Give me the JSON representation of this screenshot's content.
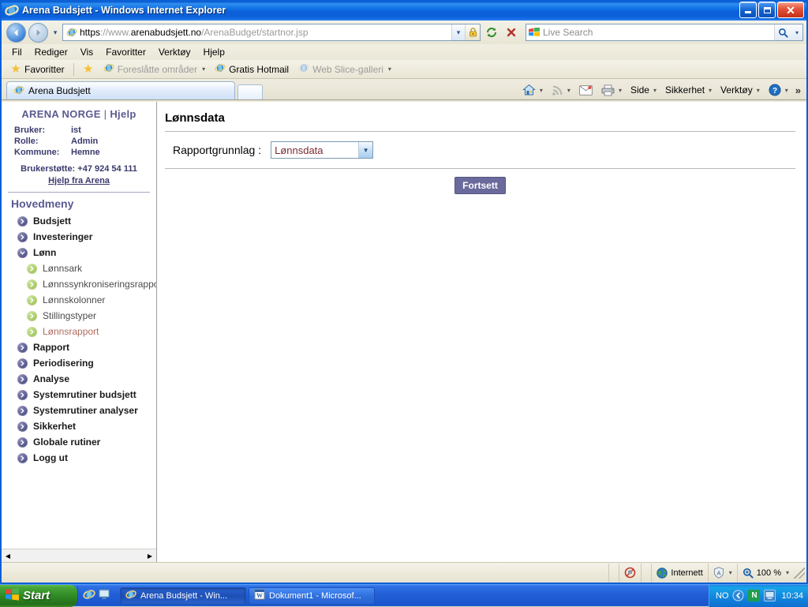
{
  "window": {
    "title": "Arena Budsjett - Windows Internet Explorer",
    "minimize_label": "Minimer",
    "restore_label": "Gjenopprett",
    "close_label": "Lukk"
  },
  "navigation": {
    "back_label": "Tilbake",
    "forward_label": "Fremover",
    "history_label": "Nylige sider",
    "url_scheme": "https",
    "url_sep": "://www.",
    "url_host": "arenabudsjett.no",
    "url_path": "/ArenaBudget/startnor.jsp",
    "url_full": "https://www.arenabudsjett.no/ArenaBudget/startnor.jsp",
    "refresh_label": "Oppdater",
    "stop_label": "Stopp",
    "lock_label": "Sikkerhetsrapport"
  },
  "search": {
    "placeholder": "Live Search",
    "go_label": "Søk",
    "provider_label": "Søkeleverandører"
  },
  "menu": {
    "items": [
      {
        "label": "Fil"
      },
      {
        "label": "Rediger"
      },
      {
        "label": "Vis"
      },
      {
        "label": "Favoritter"
      },
      {
        "label": "Verktøy"
      },
      {
        "label": "Hjelp"
      }
    ]
  },
  "favorites_bar": {
    "favorites_label": "Favoritter",
    "items": [
      {
        "label": "Foreslåtte områder",
        "dim": true,
        "caret": true
      },
      {
        "label": "Gratis Hotmail",
        "dim": false,
        "caret": false
      },
      {
        "label": "Web Slice-galleri",
        "dim": true,
        "caret": true
      }
    ]
  },
  "tabs": {
    "items": [
      {
        "label": "Arena Budsjett"
      }
    ],
    "new_tab_label": "Ny fane"
  },
  "command_bar": {
    "home_label": "Hjem",
    "feeds_label": "Feeds",
    "mail_label": "Les e-post",
    "print_label": "Skriv ut",
    "items": [
      {
        "label": "Side"
      },
      {
        "label": "Sikkerhet"
      },
      {
        "label": "Verktøy"
      }
    ],
    "help_label": "Hjelp",
    "overflow_label": "»"
  },
  "sidebar": {
    "brand": "ARENA NORGE",
    "separator": "|",
    "help_link": "Hjelp",
    "info": [
      {
        "key": "Bruker:",
        "value": "ist"
      },
      {
        "key": "Rolle:",
        "value": "Admin"
      },
      {
        "key": "Kommune:",
        "value": "Hemne"
      }
    ],
    "support_text": "Brukerstøtte: +47 924 54 111",
    "support_link": "Hjelp fra Arena",
    "menu_title": "Hovedmeny",
    "items": [
      {
        "label": "Budsjett",
        "level": 0,
        "expanded": false
      },
      {
        "label": "Investeringer",
        "level": 0,
        "expanded": false
      },
      {
        "label": "Lønn",
        "level": 0,
        "expanded": true
      },
      {
        "label": "Lønnsark",
        "level": 1,
        "active": false
      },
      {
        "label": "Lønnssynkroniseringsrappo",
        "level": 1,
        "active": false
      },
      {
        "label": "Lønnskolonner",
        "level": 1,
        "active": false
      },
      {
        "label": "Stillingstyper",
        "level": 1,
        "active": false
      },
      {
        "label": "Lønnsrapport",
        "level": 1,
        "active": true
      },
      {
        "label": "Rapport",
        "level": 0,
        "expanded": false
      },
      {
        "label": "Periodisering",
        "level": 0,
        "expanded": false
      },
      {
        "label": "Analyse",
        "level": 0,
        "expanded": false
      },
      {
        "label": "Systemrutiner budsjett",
        "level": 0,
        "expanded": false
      },
      {
        "label": "Systemrutiner analyser",
        "level": 0,
        "expanded": false
      },
      {
        "label": "Sikkerhet",
        "level": 0,
        "expanded": false
      },
      {
        "label": "Globale rutiner",
        "level": 0,
        "expanded": false
      },
      {
        "label": "Logg ut",
        "level": 0,
        "expanded": false
      }
    ],
    "scroll_left_label": "◀",
    "scroll_right_label": "▶"
  },
  "content": {
    "title": "Lønnsdata",
    "form_label": "Rapportgrunnlag :",
    "select_value": "Lønnsdata",
    "select_options": [
      "Lønnsdata"
    ],
    "submit_label": "Fortsett"
  },
  "status_bar": {
    "blocked_label": "Popup blokkert",
    "zone_label": "Internett",
    "protected_label": "Beskyttet modus",
    "zoom_label": "100 %"
  },
  "taskbar": {
    "start_label": "Start",
    "quick_launch": [
      {
        "name": "internet-explorer-icon"
      },
      {
        "name": "show-desktop-icon"
      }
    ],
    "windows": [
      {
        "label": "Arena Budsjett - Win...",
        "active": true
      },
      {
        "label": "Dokument1 - Microsof...",
        "active": false
      }
    ],
    "language": "NO",
    "clock": "10:34",
    "tray_icons": [
      {
        "name": "show-hidden-icons-chevron"
      },
      {
        "name": "norman-antivirus-icon",
        "glyph": "N"
      },
      {
        "name": "network-icon"
      }
    ]
  },
  "colors": {
    "title_bar_blue": "#0a5fd4",
    "accent_purple": "#5a5a91",
    "button_purple": "#6a6a9c",
    "active_link_red": "#b06a5e",
    "select_text": "#7a2a33",
    "bullet_green": "#a8cc6b"
  }
}
